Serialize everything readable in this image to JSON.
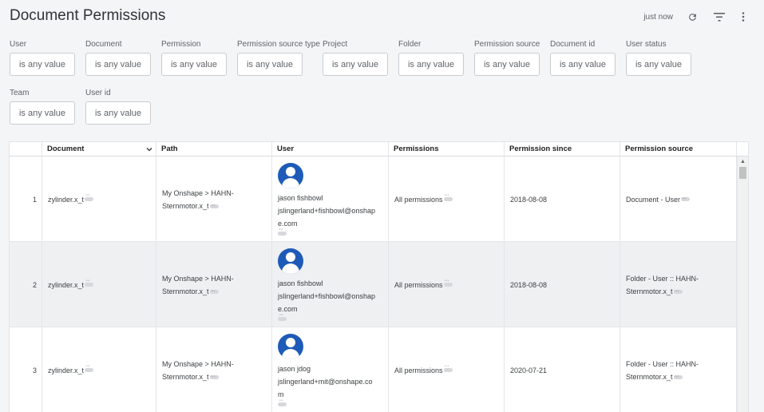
{
  "page": {
    "title": "Document Permissions",
    "refreshed": "just now"
  },
  "filters": [
    {
      "label": "User",
      "value": "is any value"
    },
    {
      "label": "Document",
      "value": "is any value"
    },
    {
      "label": "Permission",
      "value": "is any value"
    },
    {
      "label": "Permission source type",
      "value": "is any value"
    },
    {
      "label": "Project",
      "value": "is any value"
    },
    {
      "label": "Folder",
      "value": "is any value"
    },
    {
      "label": "Permission source",
      "value": "is any value"
    },
    {
      "label": "Document id",
      "value": "is any value"
    },
    {
      "label": "User status",
      "value": "is any value"
    },
    {
      "label": "Team",
      "value": "is any value"
    },
    {
      "label": "User id",
      "value": "is any value"
    }
  ],
  "table": {
    "columns": [
      "Document",
      "Path",
      "User",
      "Permissions",
      "Permission since",
      "Permission source"
    ],
    "rows": [
      {
        "num": "1",
        "document": "zylinder.x_t",
        "path1": "My Onshape > HAHN-",
        "path2": "Sternmotor.x_t",
        "user_name": "jason fishbowl",
        "user_email1": "jslingerland+fishbowl@onshap",
        "user_email2": "e.com",
        "permissions": "All permissions",
        "since": "2018-08-08",
        "source1": "Document - User",
        "source2": ""
      },
      {
        "num": "2",
        "document": "zylinder.x_t",
        "path1": "My Onshape > HAHN-",
        "path2": "Sternmotor.x_t",
        "user_name": "jason fishbowl",
        "user_email1": "jslingerland+fishbowl@onshap",
        "user_email2": "e.com",
        "permissions": "All permissions",
        "since": "2018-08-08",
        "source1": "Folder - User :: HAHN-",
        "source2": "Sternmotor.x_t"
      },
      {
        "num": "3",
        "document": "zylinder.x_t",
        "path1": "My Onshape > HAHN-",
        "path2": "Sternmotor.x_t",
        "user_name": "jason jdog",
        "user_email1": "jslingerland+mit@onshape.co",
        "user_email2": "m",
        "permissions": "All permissions",
        "since": "2020-07-21",
        "source1": "Folder - User :: HAHN-",
        "source2": "Sternmotor.x_t"
      }
    ]
  }
}
